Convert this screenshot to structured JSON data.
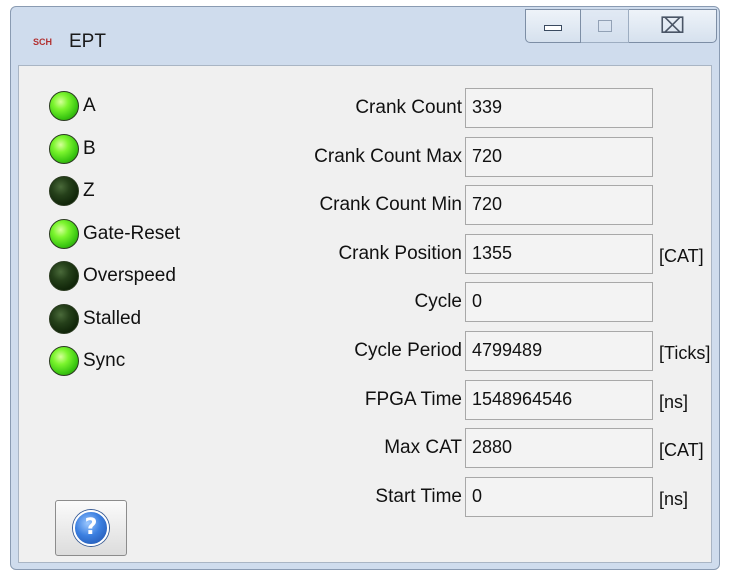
{
  "window": {
    "title": "EPT",
    "app_icon_text": "SCH",
    "close_glyph": "⌧"
  },
  "indicators": [
    {
      "label": "A",
      "state": "on"
    },
    {
      "label": "B",
      "state": "on"
    },
    {
      "label": "Z",
      "state": "off"
    },
    {
      "label": "Gate-Reset",
      "state": "on"
    },
    {
      "label": "Overspeed",
      "state": "off"
    },
    {
      "label": "Stalled",
      "state": "off"
    },
    {
      "label": "Sync",
      "state": "on"
    }
  ],
  "fields": [
    {
      "label": "Crank Count",
      "value": "339",
      "unit": ""
    },
    {
      "label": "Crank Count Max",
      "value": "720",
      "unit": ""
    },
    {
      "label": "Crank Count Min",
      "value": "720",
      "unit": ""
    },
    {
      "label": "Crank Position",
      "value": "1355",
      "unit": "[CAT]"
    },
    {
      "label": "Cycle",
      "value": "0",
      "unit": ""
    },
    {
      "label": "Cycle Period",
      "value": "4799489",
      "unit": "[Ticks]"
    },
    {
      "label": "FPGA Time",
      "value": "1548964546",
      "unit": "[ns]"
    },
    {
      "label": "Max CAT",
      "value": "2880",
      "unit": "[CAT]"
    },
    {
      "label": "Start Time",
      "value": "0",
      "unit": "[ns]"
    }
  ],
  "help": {
    "glyph": "?"
  },
  "colors": {
    "led_on": "#3cc812",
    "led_off": "#0f2408",
    "window_frame": "#cfdced"
  }
}
